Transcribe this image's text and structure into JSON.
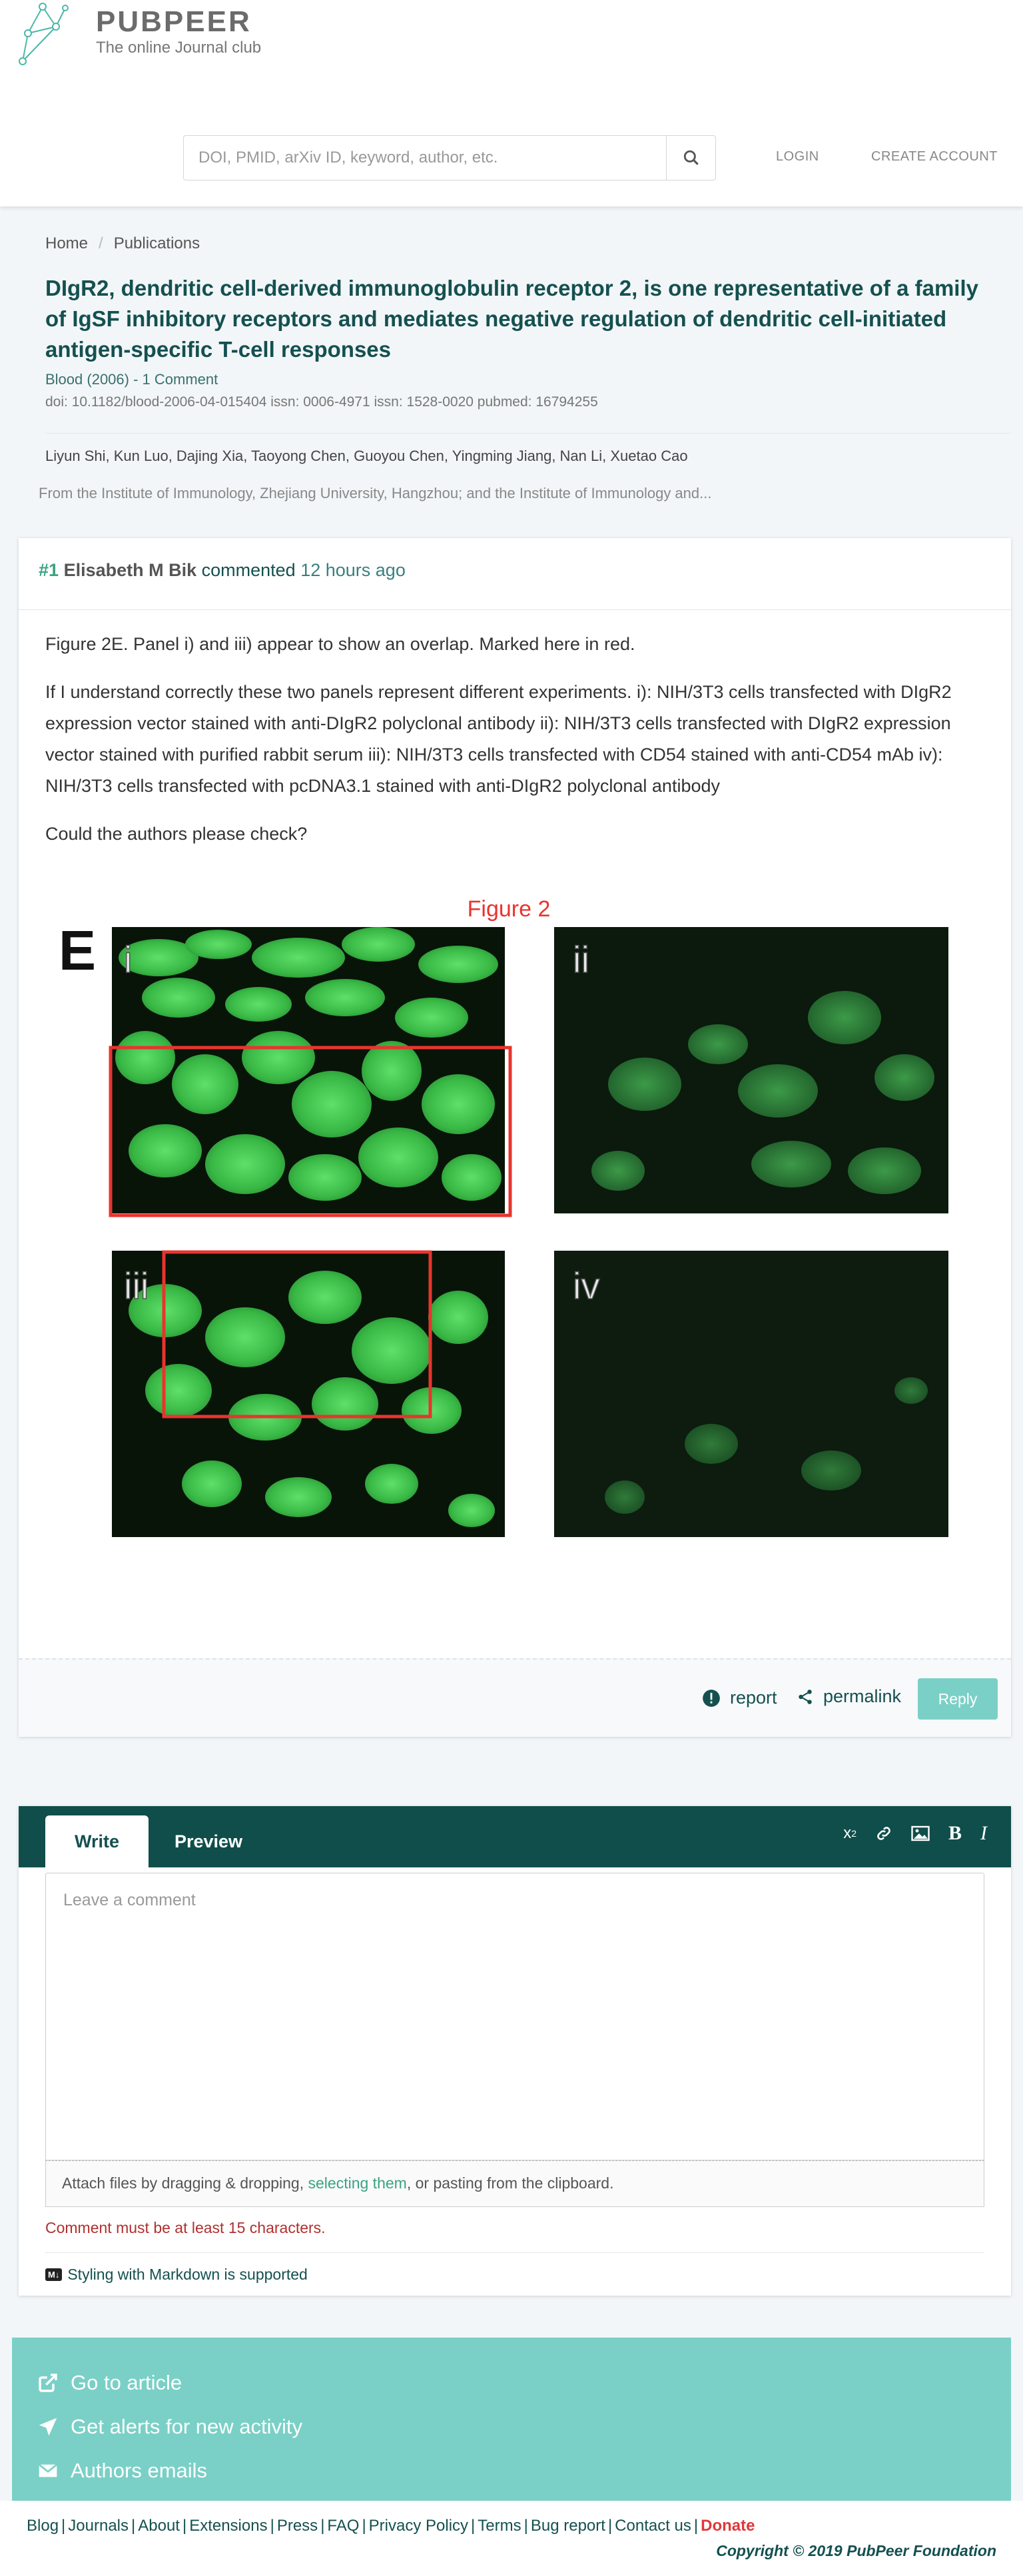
{
  "header": {
    "brand": "PUBPEER",
    "tagline": "The online Journal club",
    "search_placeholder": "DOI, PMID, arXiv ID, keyword, author, etc.",
    "login": "LOGIN",
    "create_account": "CREATE ACCOUNT"
  },
  "breadcrumb": {
    "home": "Home",
    "publications": "Publications"
  },
  "publication": {
    "title": "DIgR2, dendritic cell-derived immunoglobulin receptor 2, is one representative of a family of IgSF inhibitory receptors and mediates negative regulation of dendritic cell-initiated antigen-specific T-cell responses",
    "journal_line": "Blood (2006) - 1 Comment",
    "ids_line": "doi: 10.1182/blood-2006-04-015404  issn: 0006-4971  issn: 1528-0020  pubmed: 16794255",
    "authors": "Liyun Shi, Kun Luo, Dajing Xia, Taoyong Chen, Guoyou Chen, Yingming Jiang, Nan Li, Xuetao Cao",
    "affiliation": "From the Institute of Immunology, Zhejiang University, Hangzhou; and the Institute of Immunology and..."
  },
  "comment": {
    "number": "#1",
    "author": "Elisabeth M Bik",
    "verb": "commented",
    "time": "12 hours ago",
    "paragraphs": [
      "Figure 2E. Panel i) and iii) appear to show an overlap. Marked here in red.",
      "If I understand correctly these two panels represent different experiments. i): NIH/3T3 cells transfected with DIgR2 expression vector stained with anti-DIgR2 polyclonal antibody ii): NIH/3T3 cells transfected with DIgR2 expression vector stained with purified rabbit serum iii): NIH/3T3 cells transfected with CD54 stained with anti-CD54 mAb iv): NIH/3T3 cells transfected with pcDNA3.1 stained with anti-DIgR2 polyclonal antibody",
      "Could the authors please check?"
    ],
    "figure": {
      "title": "Figure 2",
      "panel_letter": "E",
      "panels": [
        "i",
        "ii",
        "iii",
        "iv"
      ],
      "highlight_color": "#e8342e",
      "stain_color": "#3fc24a"
    },
    "actions": {
      "report": "report",
      "permalink": "permalink",
      "reply": "Reply"
    }
  },
  "composer": {
    "tabs": [
      "Write",
      "Preview"
    ],
    "toolbar_icons": [
      "superscript-icon",
      "link-icon",
      "image-icon",
      "bold-icon",
      "italic-icon"
    ],
    "placeholder": "Leave a comment",
    "attach_prefix": "Attach files by dragging & dropping, ",
    "attach_link": "selecting them",
    "attach_suffix": ", or pasting from the clipboard.",
    "error": "Comment must be at least 15 characters.",
    "markdown_badge": "M↓",
    "markdown_note": "Styling with Markdown is supported"
  },
  "sidebar_actions": [
    "Go to article",
    "Get alerts for new activity",
    "Authors emails"
  ],
  "footer": {
    "links": [
      "Blog",
      "Journals",
      "About",
      "Extensions",
      "Press",
      "FAQ",
      "Privacy Policy",
      "Terms",
      "Bug report",
      "Contact us"
    ],
    "donate": "Donate",
    "copyright": "Copyright © 2019 PubPeer Foundation"
  },
  "colors": {
    "brand_dark": "#155050",
    "accent_green": "#3aa383",
    "teal_panel": "#7ad0c6",
    "composer_bar": "#0f4e4a",
    "error": "#b03030",
    "donate": "#e0383a"
  }
}
